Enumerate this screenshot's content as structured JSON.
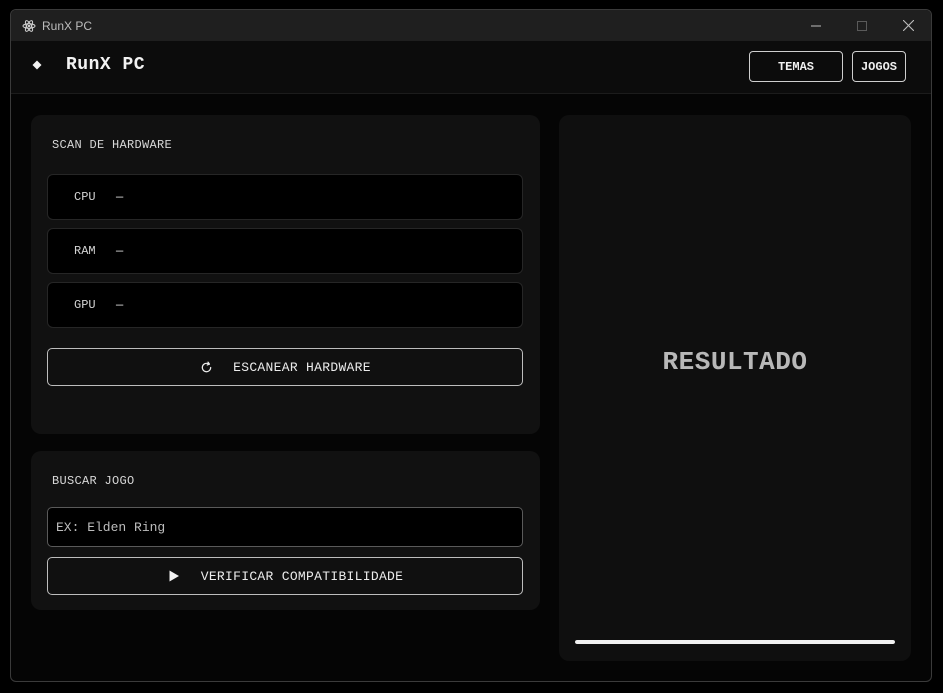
{
  "window": {
    "title": "RunX PC"
  },
  "header": {
    "title": "RunX PC",
    "buttons": {
      "temas": "TEMAS",
      "jogos": "JOGOS"
    }
  },
  "scan": {
    "title": "SCAN DE HARDWARE",
    "rows": [
      {
        "label": "CPU",
        "value": "—"
      },
      {
        "label": "RAM",
        "value": "—"
      },
      {
        "label": "GPU",
        "value": "—"
      }
    ],
    "button_label": "ESCANEAR HARDWARE"
  },
  "busca": {
    "title": "BUSCAR JOGO",
    "input_value": "",
    "input_placeholder": "EX: Elden Ring",
    "button_label": "VERIFICAR COMPATIBILIDADE"
  },
  "result": {
    "label": "RESULTADO",
    "progress": 1.0
  },
  "icons": {
    "app": "atom-icon",
    "brand": "diamond-icon",
    "scan": "refresh-icon",
    "verify": "play-icon",
    "minimize": "minimize-icon",
    "maximize": "maximize-icon",
    "close": "close-icon"
  },
  "colors": {
    "background": "#050505",
    "panel": "#111111",
    "accent": "#f2f2f2"
  }
}
